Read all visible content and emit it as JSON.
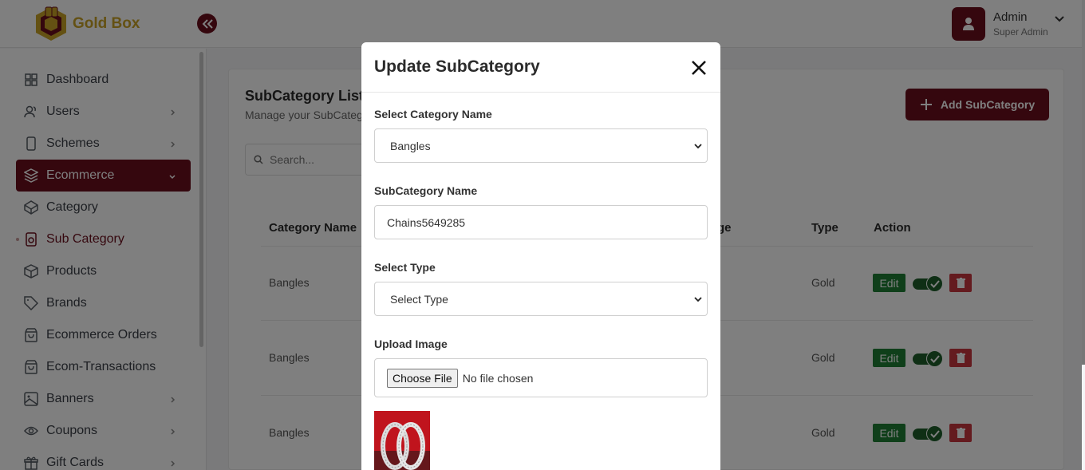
{
  "header": {
    "brand": "Gold Box",
    "user_name": "Admin",
    "user_role": "Super Admin"
  },
  "sidebar": {
    "items": [
      {
        "label": "Dashboard",
        "icon": "grid-icon",
        "has_chevron": false
      },
      {
        "label": "Users",
        "icon": "users-icon",
        "has_chevron": true
      },
      {
        "label": "Schemes",
        "icon": "phone-icon",
        "has_chevron": true
      },
      {
        "label": "Ecommerce",
        "icon": "layers-icon",
        "has_chevron": true,
        "active": true
      },
      {
        "label": "Category",
        "icon": "codepen-icon",
        "has_chevron": false
      },
      {
        "label": "Sub Category",
        "icon": "speaker-icon",
        "has_chevron": false,
        "current": true
      },
      {
        "label": "Products",
        "icon": "box-icon",
        "has_chevron": false
      },
      {
        "label": "Brands",
        "icon": "tag-icon",
        "has_chevron": false
      },
      {
        "label": "Ecommerce Orders",
        "icon": "shopping-bag-icon",
        "has_chevron": false
      },
      {
        "label": "Ecom-Transactions",
        "icon": "shopping-bag-icon",
        "has_chevron": false
      },
      {
        "label": "Banners",
        "icon": "image-icon",
        "has_chevron": true
      },
      {
        "label": "Coupons",
        "icon": "eye-icon",
        "has_chevron": true
      },
      {
        "label": "Gift Cards",
        "icon": "gift-icon",
        "has_chevron": true
      }
    ]
  },
  "main": {
    "title": "SubCategory List",
    "subtitle": "Manage your SubCateg",
    "add_button": "Add SubCategory",
    "search_placeholder": "Search...",
    "columns": {
      "category": "Category Name",
      "image_partial": "ge",
      "type": "Type",
      "action": "Action"
    },
    "rows": [
      {
        "category": "Bangles",
        "type": "Gold",
        "edit": "Edit"
      },
      {
        "category": "Bangles",
        "type": "Gold",
        "edit": "Edit"
      },
      {
        "category": "Bangles",
        "type": "Gold",
        "edit": "Edit"
      }
    ]
  },
  "modal": {
    "title": "Update SubCategory",
    "category_label": "Select Category Name",
    "category_value": "Bangles",
    "name_label": "SubCategory Name",
    "name_value": "Chains5649285",
    "type_label": "Select Type",
    "type_value": "Select Type",
    "upload_label": "Upload Image",
    "choose_file": "Choose File",
    "no_file": "No file chosen"
  },
  "colors": {
    "brand_primary": "#6a0f1d",
    "brand_gold": "#c9a227",
    "success": "#1e7e34",
    "danger": "#c9363e"
  }
}
